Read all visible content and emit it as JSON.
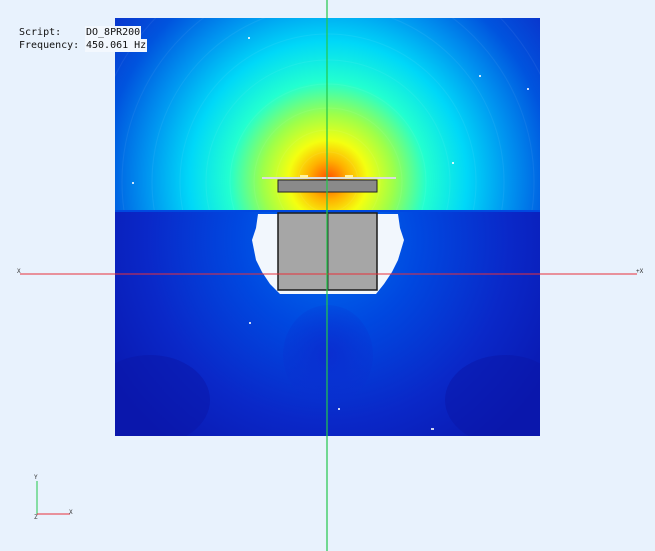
{
  "info": {
    "script_label": "Script:",
    "script_value": "DO_8PR200",
    "frequency_label": "Frequency:",
    "frequency_value": "450.061 Hz"
  },
  "axes_triad": {
    "y_label": "Y",
    "x_label": "X",
    "z_label": "Z"
  },
  "axis_labels": {
    "x_left": "X",
    "x_right": "+X"
  },
  "colors": {
    "background": "#e8f2fd",
    "x_axis": "#e8303a",
    "y_axis": "#22c84a",
    "model_body": "#a6a6a6",
    "field_hot": "#ff5a00",
    "field_cold": "#0a1ec8"
  }
}
